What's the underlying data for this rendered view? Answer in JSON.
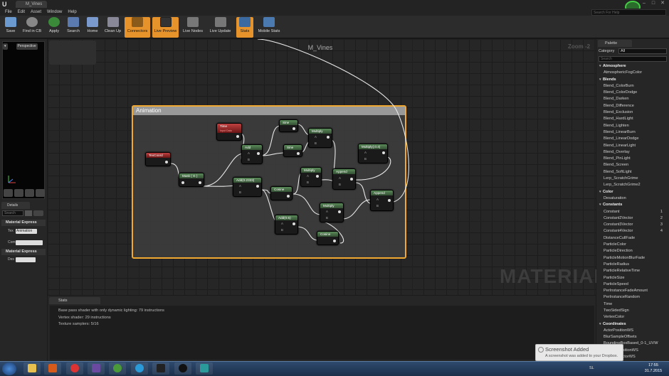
{
  "window": {
    "tab_title": "M_Vines",
    "logo": "U"
  },
  "menu": [
    "File",
    "Edit",
    "Asset",
    "Window",
    "Help"
  ],
  "help_search": {
    "placeholder": "Search For Help"
  },
  "toolbar": [
    {
      "label": "Save",
      "icon": "save-icon",
      "active": false
    },
    {
      "label": "Find in CB",
      "icon": "find-in-cb-icon",
      "active": false
    },
    {
      "label": "Apply",
      "icon": "apply-icon",
      "active": false
    },
    {
      "label": "Search",
      "icon": "search-icon",
      "active": false
    },
    {
      "label": "Home",
      "icon": "home-icon",
      "active": false
    },
    {
      "label": "Clean Up",
      "icon": "clean-up-icon",
      "active": false
    },
    {
      "label": "Connectors",
      "icon": "connectors-icon",
      "active": true
    },
    {
      "label": "Live Preview",
      "icon": "live-preview-icon",
      "active": true
    },
    {
      "label": "Live Nodes",
      "icon": "live-nodes-icon",
      "active": false
    },
    {
      "label": "Live Update",
      "icon": "live-update-icon",
      "active": false
    },
    {
      "label": "Stats",
      "icon": "stats-icon",
      "active": true
    },
    {
      "label": "Mobile Stats",
      "icon": "mobile-stats-icon",
      "active": false
    }
  ],
  "viewport": {
    "mode": "Perspective"
  },
  "details": {
    "tab": "Details",
    "search_placeholder": "Search",
    "section1": "Material Express",
    "row1_label": "Tex",
    "row1_value": "Animation",
    "row2_label": "Com",
    "section2": "Material Express",
    "row3_label": "Des"
  },
  "graph": {
    "title": "M_Vines",
    "zoom": "Zoom -2",
    "watermark": "MATERIAL",
    "comment": "Animation",
    "nodes": {
      "texcoord": "TexCoord",
      "time": "Time",
      "time_sub": "Input Data",
      "mask": "Mask ( G )",
      "add1": "Add",
      "add2": "Add(0.2333)",
      "add3": "Add(0.5)",
      "sine1": "Sine",
      "sine2": "Sine",
      "cosine1": "Cosine",
      "cosine2": "Cosine",
      "mult1": "Multiply",
      "mult2": "Multiply",
      "mult3": "Multiply",
      "mult4": "Multiply(,0.4)",
      "append1": "Append",
      "append2": "Append",
      "pin_a": "A",
      "pin_b": "B"
    }
  },
  "palette": {
    "tab": "Palette",
    "category_label": "Category",
    "category_value": "All",
    "search_placeholder": "Search",
    "items": [
      {
        "text": "Atmosphere",
        "cat": true,
        "sc": ""
      },
      {
        "text": "AtmosphericFogColor",
        "cat": false,
        "sc": ""
      },
      {
        "text": "Blends",
        "cat": true,
        "sc": ""
      },
      {
        "text": "Blend_ColorBurn",
        "cat": false,
        "sc": ""
      },
      {
        "text": "Blend_ColorDodge",
        "cat": false,
        "sc": ""
      },
      {
        "text": "Blend_Darken",
        "cat": false,
        "sc": ""
      },
      {
        "text": "Blend_Difference",
        "cat": false,
        "sc": ""
      },
      {
        "text": "Blend_Exclusion",
        "cat": false,
        "sc": ""
      },
      {
        "text": "Blend_HardLight",
        "cat": false,
        "sc": ""
      },
      {
        "text": "Blend_Lighten",
        "cat": false,
        "sc": ""
      },
      {
        "text": "Blend_LinearBurn",
        "cat": false,
        "sc": ""
      },
      {
        "text": "Blend_LinearDodge",
        "cat": false,
        "sc": ""
      },
      {
        "text": "Blend_LinearLight",
        "cat": false,
        "sc": ""
      },
      {
        "text": "Blend_Overlay",
        "cat": false,
        "sc": ""
      },
      {
        "text": "Blend_PinLight",
        "cat": false,
        "sc": ""
      },
      {
        "text": "Blend_Screen",
        "cat": false,
        "sc": ""
      },
      {
        "text": "Blend_SoftLight",
        "cat": false,
        "sc": ""
      },
      {
        "text": "Lerp_ScratchGrime",
        "cat": false,
        "sc": ""
      },
      {
        "text": "Lerp_ScratchGrime2",
        "cat": false,
        "sc": ""
      },
      {
        "text": "Color",
        "cat": true,
        "sc": ""
      },
      {
        "text": "Desaturation",
        "cat": false,
        "sc": ""
      },
      {
        "text": "Constants",
        "cat": true,
        "sc": ""
      },
      {
        "text": "Constant",
        "cat": false,
        "sc": "1"
      },
      {
        "text": "Constant2Vector",
        "cat": false,
        "sc": "2"
      },
      {
        "text": "Constant3Vector",
        "cat": false,
        "sc": "3"
      },
      {
        "text": "Constant4Vector",
        "cat": false,
        "sc": "4"
      },
      {
        "text": "DistanceCullFade",
        "cat": false,
        "sc": ""
      },
      {
        "text": "ParticleColor",
        "cat": false,
        "sc": ""
      },
      {
        "text": "ParticleDirection",
        "cat": false,
        "sc": ""
      },
      {
        "text": "ParticleMotionBlurFade",
        "cat": false,
        "sc": ""
      },
      {
        "text": "ParticleRadius",
        "cat": false,
        "sc": ""
      },
      {
        "text": "ParticleRelativeTime",
        "cat": false,
        "sc": ""
      },
      {
        "text": "ParticleSize",
        "cat": false,
        "sc": ""
      },
      {
        "text": "ParticleSpeed",
        "cat": false,
        "sc": ""
      },
      {
        "text": "PerInstanceFadeAmount",
        "cat": false,
        "sc": ""
      },
      {
        "text": "PerInstanceRandom",
        "cat": false,
        "sc": ""
      },
      {
        "text": "Time",
        "cat": false,
        "sc": ""
      },
      {
        "text": "TwoSidedSign",
        "cat": false,
        "sc": ""
      },
      {
        "text": "VertexColor",
        "cat": false,
        "sc": ""
      },
      {
        "text": "Coordinates",
        "cat": true,
        "sc": ""
      },
      {
        "text": "ActorPositionWS",
        "cat": false,
        "sc": ""
      },
      {
        "text": "BlurSampleOffsets",
        "cat": false,
        "sc": ""
      },
      {
        "text": "BoundingBoxBased_0-1_UVW",
        "cat": false,
        "sc": ""
      },
      {
        "text": "CameraPositionWS",
        "cat": false,
        "sc": ""
      },
      {
        "text": "CameraVectorWS",
        "cat": false,
        "sc": ""
      }
    ]
  },
  "stats": {
    "tab": "Stats",
    "lines": [
      "Base pass shader with only dynamic lighting: 79 instructions",
      "Vertex shader: 29 instructions",
      "Texture samplers: 5/16"
    ]
  },
  "toast": {
    "title": "Screenshot Added",
    "message": "A screenshot was added to your Dropbox."
  },
  "taskbar": {
    "apps": [
      "explorer-icon",
      "media-player-icon",
      "chrome-icon",
      "visual-studio-icon",
      "utorrent-icon",
      "skype-icon",
      "epic-launcher-icon",
      "unreal-icon",
      "maya-icon"
    ],
    "lang": "SL",
    "time": "17:55",
    "date": "31.7.2015"
  },
  "colors": {
    "accent": "#e6932b",
    "comment_border": "#f0a830",
    "node_green": "#4a7a4a",
    "node_red": "#a02828"
  }
}
